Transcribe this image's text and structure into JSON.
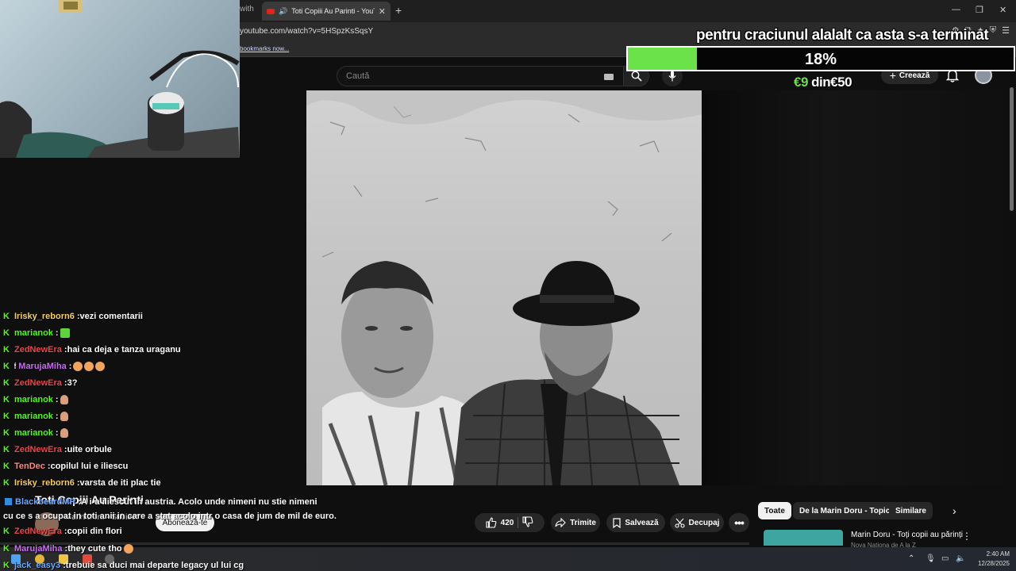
{
  "browser": {
    "prev_tab_fragment": "with",
    "active_tab_title": "Toti Copiii Au Parinti - YouTube",
    "url": "youtube.com/watch?v=5HSpzKsSqsY",
    "bookmarks_link": "bookmarks now..."
  },
  "youtube": {
    "search_placeholder": "Caută",
    "create_label": "Creează",
    "video_title": "Toti Copiii Au Parinti",
    "channel_name": "Marin Doru - Subiect",
    "subscribe_label": "Abonează-te",
    "like_count": "420",
    "share_label": "Trimite",
    "save_label": "Salvează",
    "clip_label": "Decupaj",
    "chips": [
      "Toate",
      "De la Marin Doru - Topic",
      "Similare"
    ],
    "rec_title": "Marin Doru - Toți copii au părinți",
    "rec_sub": "Nova Nationa de A la Z"
  },
  "overlay": {
    "goal_title": "pentru craciunul alalalt ca asta s-a terminat",
    "goal_percent_label": "18%",
    "goal_fraction": 0.18,
    "goal_raised": "€9",
    "goal_separator": "din",
    "goal_target": "€50",
    "accent": "#6be14a"
  },
  "chat": [
    {
      "user": "Irisky_reborn6",
      "color": "#f5d061",
      "msg": "vezi comentarii",
      "emotes": []
    },
    {
      "user": "marianok",
      "color": "#53fc18",
      "msg": "",
      "emotes": [
        "g"
      ]
    },
    {
      "user": "ZedNewEra",
      "color": "#e5484d",
      "msg": "hai ca deja e tanza uraganu",
      "emotes": []
    },
    {
      "user": "MarujaMiha",
      "color": "#c66ef0",
      "msg": "",
      "emotes": [
        "f",
        "f",
        "f"
      ],
      "badge": true
    },
    {
      "user": "ZedNewEra",
      "color": "#e5484d",
      "msg": "3?",
      "emotes": []
    },
    {
      "user": "marianok",
      "color": "#53fc18",
      "msg": "",
      "emotes": [
        "h"
      ]
    },
    {
      "user": "marianok",
      "color": "#53fc18",
      "msg": "",
      "emotes": [
        "h"
      ]
    },
    {
      "user": "marianok",
      "color": "#53fc18",
      "msg": "",
      "emotes": [
        "h"
      ]
    },
    {
      "user": "ZedNewEra",
      "color": "#e5484d",
      "msg": "uite orbule",
      "emotes": []
    },
    {
      "user": "TenDec",
      "color": "#ff8a80",
      "msg": "copilul lui e iliescu",
      "emotes": []
    },
    {
      "user": "Irisky_reborn6",
      "color": "#f5d061",
      "msg": "varsta de iti plac tie",
      "emotes": []
    }
  ],
  "chat_lower": [
    {
      "user": "BlackbeardMR",
      "color": "#6aa7ff",
      "msg": "A i-a iliescut in austria. Acolo unde nimeni nu stie nimeni",
      "icon": "blue"
    },
    {
      "user": "",
      "color": "#fff",
      "msg": "cu ce s a ocupat in toti anii in care a stat acolo intr o casa de jum de mil de euro."
    },
    {
      "user": "ZedNewEra",
      "color": "#e5484d",
      "msg": "copii din flori"
    },
    {
      "user": "MarujaMiha",
      "color": "#c66ef0",
      "msg": "they cute tho",
      "emote": "f"
    },
    {
      "user": "jack_easy3",
      "color": "#6aa7ff",
      "msg": "trebuie sa duci mai departe legacy ul lui cg"
    }
  ],
  "taskbar": {
    "time": "2:40 AM",
    "date": "12/28/2025"
  }
}
